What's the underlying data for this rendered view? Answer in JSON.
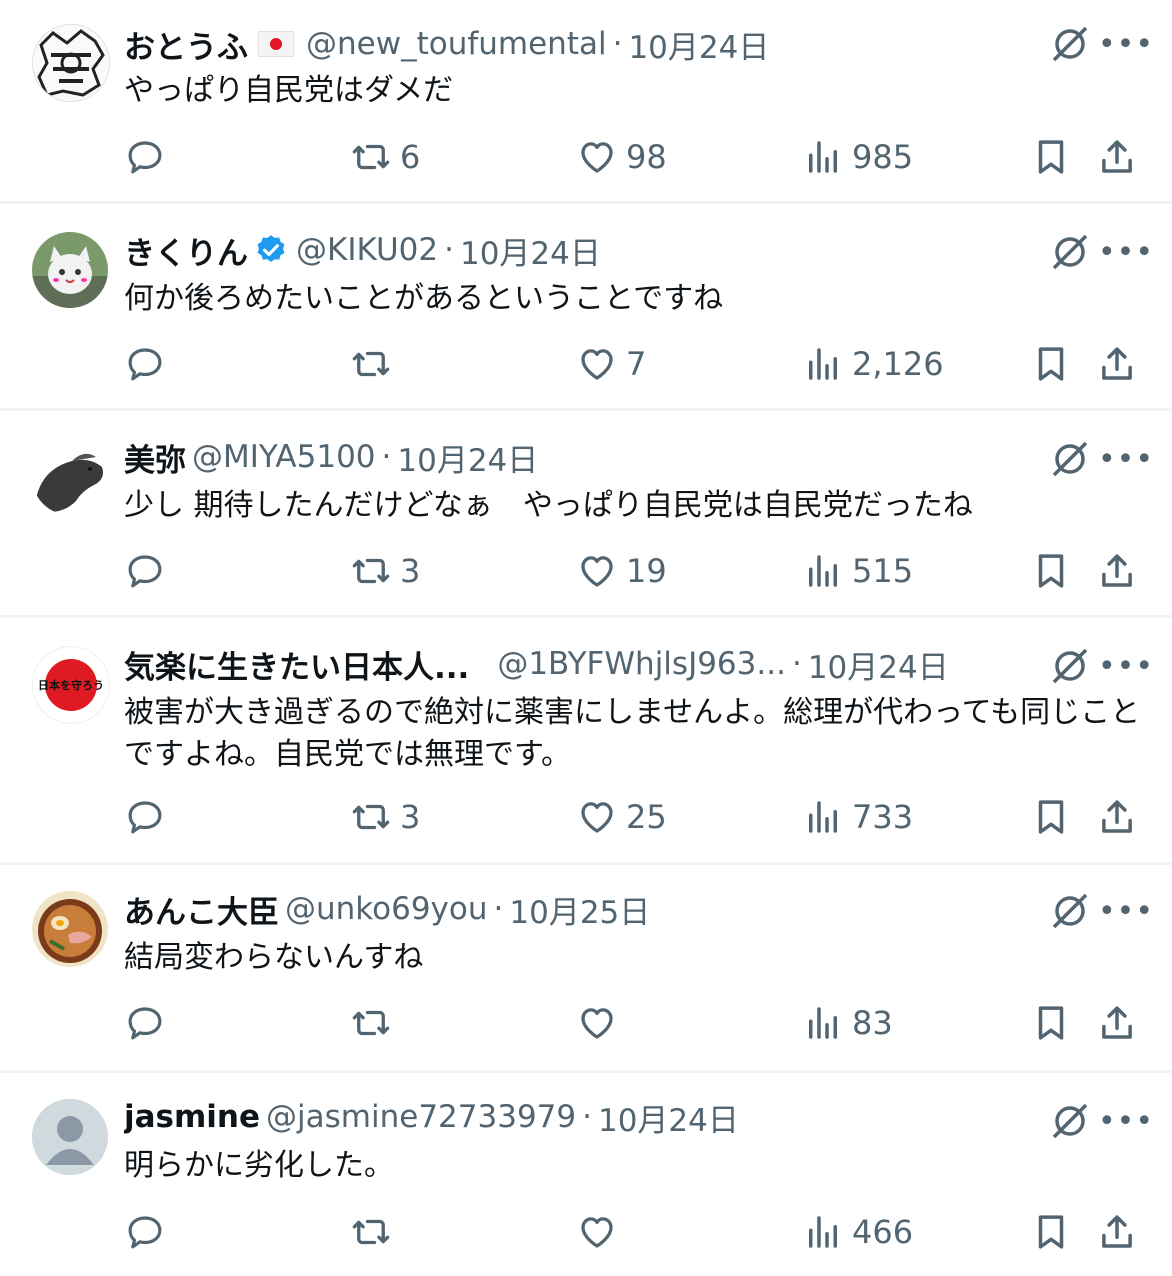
{
  "tweets": [
    {
      "name": "おとうふ",
      "has_flag": true,
      "handle": "@new_toufumental",
      "date": "10月24日",
      "text": "やっぱり自民党はダメだ",
      "replies": "",
      "retweets": "6",
      "likes": "98",
      "views": "985"
    },
    {
      "name": "きくりん",
      "verified": true,
      "handle": "@KIKU02",
      "date": "10月24日",
      "text": "何か後ろめたいことがあるということですね",
      "replies": "",
      "retweets": "",
      "likes": "7",
      "views": "2,126"
    },
    {
      "name": "美弥",
      "handle": "@MIYA5100",
      "date": "10月24日",
      "text": "少し 期待したんだけどなぁ　やっぱり自民党は自民党だったね",
      "replies": "",
      "retweets": "3",
      "likes": "19",
      "views": "515"
    },
    {
      "name": "気楽に生きたい日本人...",
      "handle": "@1BYFWhjlsJ963...",
      "date": "10月24日",
      "text": "被害が大き過ぎるので絶対に薬害にしませんよ。総理が代わっても同じことですよね。自民党では無理です。",
      "avatar_text": "日本を守ろう",
      "replies": "",
      "retweets": "3",
      "likes": "25",
      "views": "733"
    },
    {
      "name": "あんこ大臣",
      "handle": "@unko69you",
      "date": "10月25日",
      "text": "結局変わらないんすね",
      "replies": "",
      "retweets": "",
      "likes": "",
      "views": "83"
    },
    {
      "name": "jasmine",
      "handle": "@jasmine72733979",
      "date": "10月24日",
      "text": "明らかに劣化した。",
      "replies": "",
      "retweets": "",
      "likes": "",
      "views": "466"
    }
  ],
  "separator": "·",
  "more_glyph": "•••",
  "colors": {
    "text": "#0f1419",
    "secondary": "#536471",
    "verified": "#1d9bf0",
    "divider": "#eff3f4"
  },
  "icons": [
    "reply-icon",
    "retweet-icon",
    "like-icon",
    "views-icon",
    "bookmark-icon",
    "share-icon",
    "grok-icon",
    "more-icon",
    "verified-badge-icon",
    "japan-flag-icon"
  ]
}
